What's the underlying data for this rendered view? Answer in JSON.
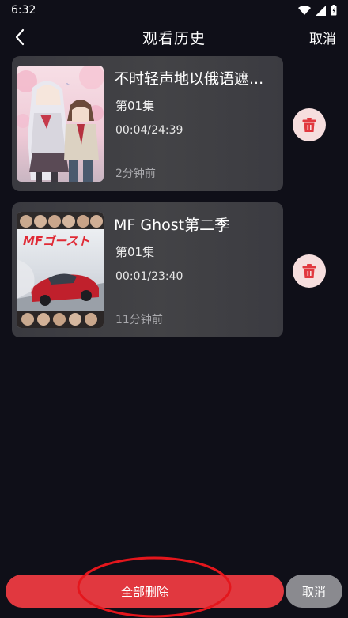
{
  "status_bar": {
    "time": "6:32"
  },
  "header": {
    "title": "观看历史",
    "cancel_label": "取消",
    "back_icon": "chevron-left-icon"
  },
  "history": [
    {
      "title": "不时轻声地以俄语遮...",
      "episode": "第01集",
      "progress": "00:04/24:39",
      "time_ago": "2分钟前",
      "cover_title": ""
    },
    {
      "title": "MF Ghost第二季",
      "episode": "第01集",
      "progress": "00:01/23:40",
      "time_ago": "11分钟前",
      "cover_title": "MFゴースト"
    }
  ],
  "bottom_bar": {
    "delete_all_label": "全部删除",
    "cancel_label": "取消"
  },
  "colors": {
    "background": "#0f0f18",
    "card": "#414145",
    "accent_red": "#e1383f",
    "delete_icon_bg": "#f6dede",
    "annotation_red": "#e4161c"
  }
}
